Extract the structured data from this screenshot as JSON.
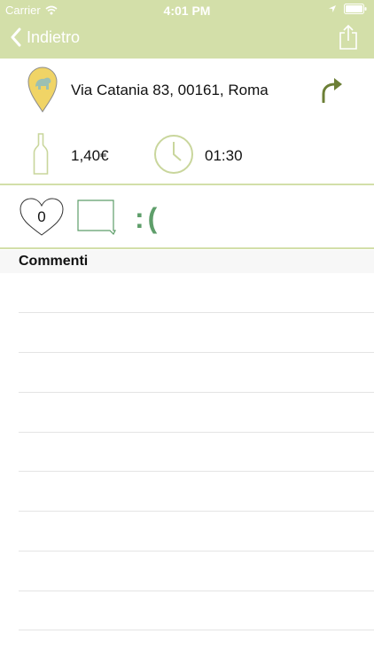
{
  "status_bar": {
    "carrier": "Carrier",
    "time": "4:01 PM"
  },
  "nav": {
    "back_label": "Indietro"
  },
  "place": {
    "address": "Via Catania 83, 00161, Roma",
    "price": "1,40€",
    "time": "01:30"
  },
  "actions": {
    "likes_count": "0",
    "face": ":("
  },
  "comments": {
    "header": "Commenti"
  },
  "colors": {
    "bar_green": "#d3dfa9",
    "accent_green": "#5e9e6a",
    "pin_yellow": "#f0d466"
  },
  "icons": [
    "wifi-icon",
    "location-arrow-icon",
    "battery-icon",
    "back-chevron-icon",
    "share-icon",
    "map-pin-icon",
    "directions-arrow-icon",
    "bottle-icon",
    "clock-icon",
    "heart-icon",
    "comment-bubble-icon"
  ]
}
